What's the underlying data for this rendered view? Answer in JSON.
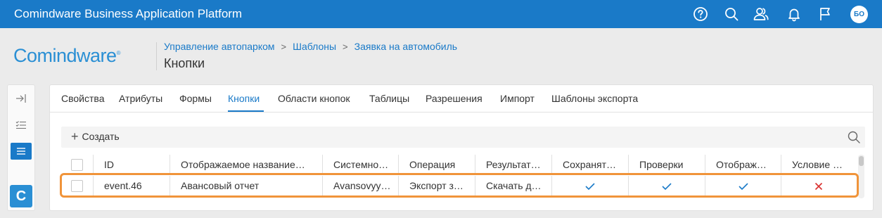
{
  "app": {
    "title": "Comindware Business Application Platform",
    "user_initials": "БО"
  },
  "topbar": {
    "icons": [
      "help-icon",
      "search-icon",
      "users-icon",
      "bell-icon",
      "flag-icon"
    ]
  },
  "logo": {
    "text": "Comindware",
    "reg": "®"
  },
  "breadcrumb": {
    "items": [
      "Управление автопарком",
      "Шаблоны",
      "Заявка на автомобиль"
    ],
    "separator": ">"
  },
  "page_title": "Кнопки",
  "leftbar": {
    "icons": [
      "collapse-panel-icon",
      "checklist-icon",
      "list-icon"
    ],
    "active": "list-icon",
    "brand_letter": "C"
  },
  "tabs": [
    {
      "label": "Свойства",
      "active": false
    },
    {
      "label": "Атрибуты",
      "active": false
    },
    {
      "label": "Формы",
      "active": false
    },
    {
      "label": "Кнопки",
      "active": true
    },
    {
      "label": "Области кнопок",
      "active": false
    },
    {
      "label": "Таблицы",
      "active": false
    },
    {
      "label": "Разрешения",
      "active": false
    },
    {
      "label": "Импорт",
      "active": false
    },
    {
      "label": "Шаблоны экспорта",
      "active": false
    }
  ],
  "toolbar": {
    "create_label": "Создать"
  },
  "table": {
    "columns": [
      "ID",
      "Отображаемое название…",
      "Системно…",
      "Операция",
      "Результат…",
      "Сохранят…",
      "Проверки",
      "Отображ…",
      "Условие …"
    ],
    "rows": [
      {
        "id": "event.46",
        "display_name": "Авансовый отчет",
        "system_name": "Avansovyy…",
        "operation": "Экспорт з…",
        "result": "Скачать д…",
        "save": "✓",
        "checks": "✓",
        "display": "✓",
        "condition": "✕"
      }
    ]
  },
  "colors": {
    "accent": "#1a7ac8",
    "highlight": "#f0943a",
    "check": "#1a7ac8",
    "cross": "#d9302f"
  }
}
